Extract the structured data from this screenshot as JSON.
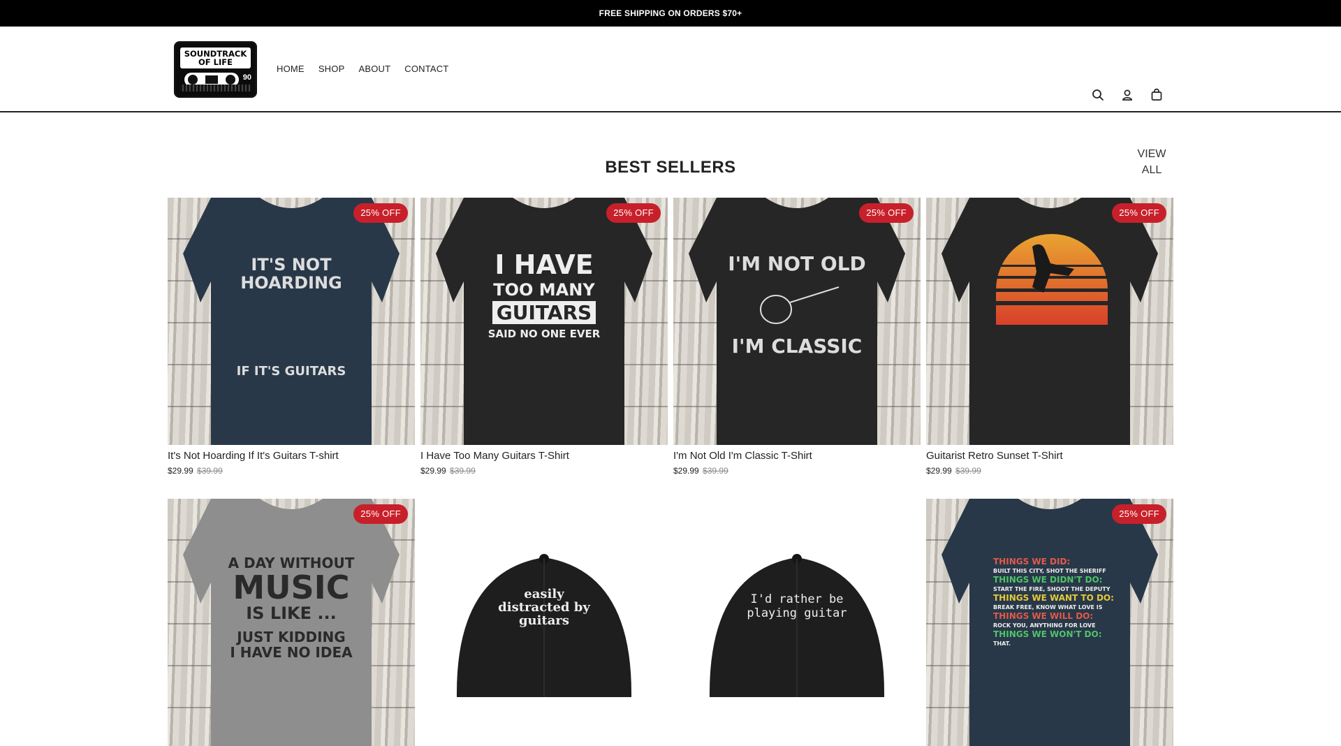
{
  "announcement": "FREE SHIPPING ON ORDERS $70+",
  "logo": {
    "line1": "SOUNDTRACK",
    "line2": "OF LIFE",
    "number": "90"
  },
  "nav": [
    "HOME",
    "SHOP",
    "ABOUT",
    "CONTACT"
  ],
  "header_icons": [
    "search-icon",
    "account-icon",
    "cart-icon"
  ],
  "section": {
    "title": "BEST SELLERS",
    "view_all": [
      "VIEW",
      "ALL"
    ]
  },
  "products": [
    {
      "name": "It's Not Hoarding If It's Guitars T-shirt",
      "price": "$29.99",
      "compare": "$39.99",
      "badge": "25% OFF",
      "shirt_color": "#283848",
      "print": [
        "IT'S NOT",
        "HOARDING",
        "IF IT'S GUITARS"
      ]
    },
    {
      "name": "I Have Too Many Guitars T-Shirt",
      "price": "$29.99",
      "compare": "$39.99",
      "badge": "25% OFF",
      "shirt_color": "#262626",
      "print": [
        "I HAVE",
        "TOO MANY",
        "GUITARS",
        "SAID NO ONE EVER"
      ]
    },
    {
      "name": "I'm Not Old I'm Classic T-Shirt",
      "price": "$29.99",
      "compare": "$39.99",
      "badge": "25% OFF",
      "shirt_color": "#262626",
      "print": [
        "I'M NOT OLD",
        "I'M CLASSIC"
      ]
    },
    {
      "name": "Guitarist Retro Sunset T-Shirt",
      "price": "$29.99",
      "compare": "$39.99",
      "badge": "25% OFF",
      "shirt_color": "#262626",
      "print": []
    },
    {
      "badge": "25% OFF",
      "shirt_color": "#8e8e8e",
      "print": [
        "A DAY WITHOUT",
        "MUSIC",
        "IS LIKE ...",
        "JUST KIDDING",
        "I HAVE NO IDEA"
      ]
    },
    {
      "print": [
        "easily",
        "distracted by",
        "guitars"
      ]
    },
    {
      "print": [
        "I'd rather be",
        "playing guitar"
      ]
    },
    {
      "badge": "25% OFF",
      "shirt_color": "#283848",
      "print": [
        "THINGS WE DID:",
        "BUILT THIS CITY, SHOT THE SHERIFF",
        "THINGS WE DIDN'T DO:",
        "START THE FIRE, SHOOT THE DEPUTY",
        "THINGS WE WANT TO DO:",
        "BREAK FREE, KNOW WHAT LOVE IS",
        "THINGS WE WILL DO:",
        "ROCK YOU, ANYTHING FOR LOVE",
        "THINGS WE WON'T DO:",
        "THAT."
      ]
    }
  ],
  "colors": {
    "badge": "#c8202a",
    "announcement_bg": "#000000",
    "text": "#222222"
  }
}
